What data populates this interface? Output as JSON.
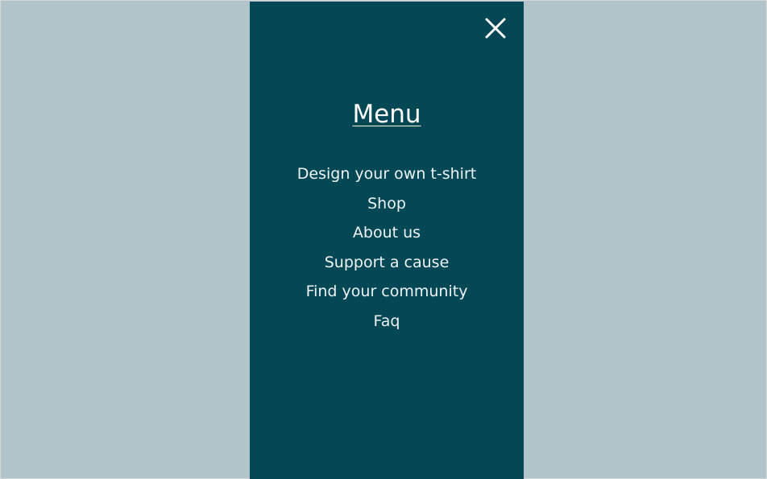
{
  "menu": {
    "title": "Menu",
    "close_icon": "close-x-icon",
    "items": [
      {
        "label": "Design your own t-shirt"
      },
      {
        "label": "Shop"
      },
      {
        "label": "About us"
      },
      {
        "label": "Support a cause"
      },
      {
        "label": "Find your community"
      },
      {
        "label": "Faq"
      }
    ]
  },
  "colors": {
    "backdrop": "#b0c4c9",
    "panel": "#044856",
    "text": "#ffffff"
  }
}
